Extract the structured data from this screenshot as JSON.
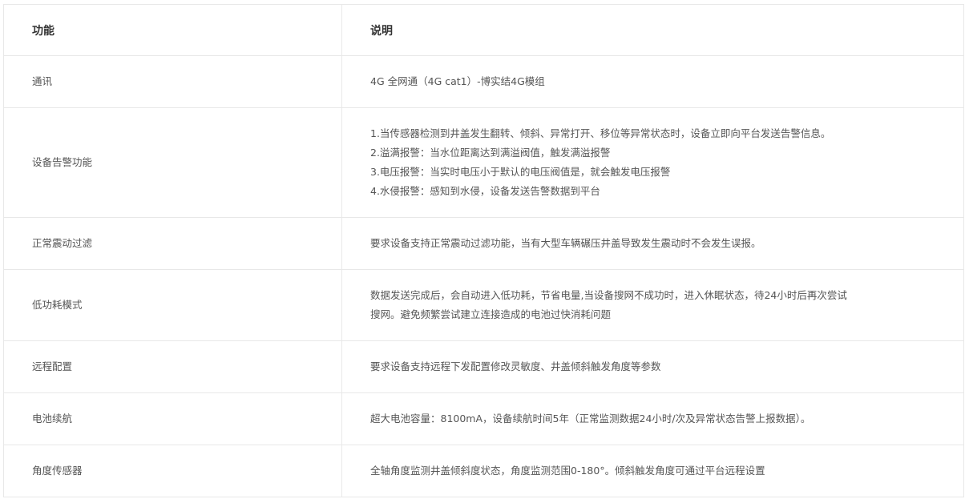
{
  "table": {
    "headers": {
      "feature": "功能",
      "description": "说明"
    },
    "rows": [
      {
        "feature": "通讯",
        "description": [
          "4G 全网通（4G cat1）-博实结4G模组"
        ]
      },
      {
        "feature": "设备告警功能",
        "description": [
          "1.当传感器检测到井盖发生翻转、倾斜、异常打开、移位等异常状态时，设备立即向平台发送告警信息。",
          "2.溢满报警：当水位距离达到满溢阀值，触发满溢报警",
          "3.电压报警：当实时电压小于默认的电压阀值是，就会触发电压报警",
          "4.水侵报警：感知到水侵，设备发送告警数据到平台"
        ]
      },
      {
        "feature": "正常震动过滤",
        "description": [
          "要求设备支持正常震动过滤功能，当有大型车辆碾压井盖导致发生震动时不会发生误报。"
        ]
      },
      {
        "feature": "低功耗模式",
        "description": [
          "数据发送完成后，会自动进入低功耗，节省电量,当设备搜网不成功时，进入休眠状态，待24小时后再次尝试",
          "搜网。避免频繁尝试建立连接造成的电池过快消耗问题"
        ]
      },
      {
        "feature": "远程配置",
        "description": [
          "要求设备支持远程下发配置修改灵敏度、井盖倾斜触发角度等参数"
        ]
      },
      {
        "feature": "电池续航",
        "description": [
          "超大电池容量：8100mA，设备续航时间5年（正常监测数据24小时/次及异常状态告警上报数据）。"
        ]
      },
      {
        "feature": "角度传感器",
        "description": [
          "全轴角度监测井盖倾斜度状态，角度监测范围0-180°。倾斜触发角度可通过平台远程设置"
        ]
      }
    ]
  }
}
